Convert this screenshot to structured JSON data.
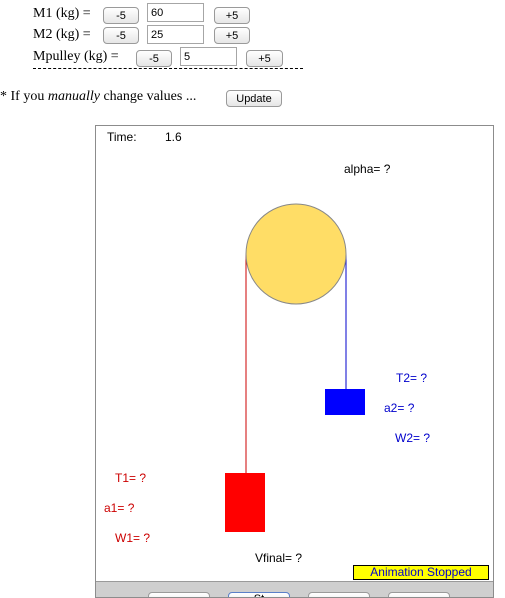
{
  "controls": {
    "m1": {
      "label": "M1 (kg) =",
      "minus": "-5",
      "value": "60",
      "plus": "+5"
    },
    "m2": {
      "label": "M2 (kg) =",
      "minus": "-5",
      "value": "25",
      "plus": "+5"
    },
    "mpulley": {
      "label": "Mpulley (kg) =",
      "minus": "-5",
      "value": "5",
      "plus": "+5"
    }
  },
  "separator": "---------------------------------------------------",
  "note": {
    "prefix": "* If you ",
    "emphasis": "manually",
    "suffix": " change values ...",
    "button": "Update"
  },
  "sim": {
    "time_label": "Time:",
    "time_value": "1.6",
    "alpha": "alpha= ?",
    "t1": "T1= ?",
    "a1": "a1= ?",
    "w1": "W1= ?",
    "t2": "T2= ?",
    "a2": "a2= ?",
    "w2": "W2= ?",
    "vfinal": "Vfinal= ?",
    "status": "Animation Stopped",
    "colors": {
      "pulley": "#FFDD66",
      "mass1": "#FF0000",
      "mass2": "#0000FF",
      "status_bg": "#FFFF00"
    },
    "control_buttons": [
      "",
      "St",
      "",
      ""
    ]
  }
}
